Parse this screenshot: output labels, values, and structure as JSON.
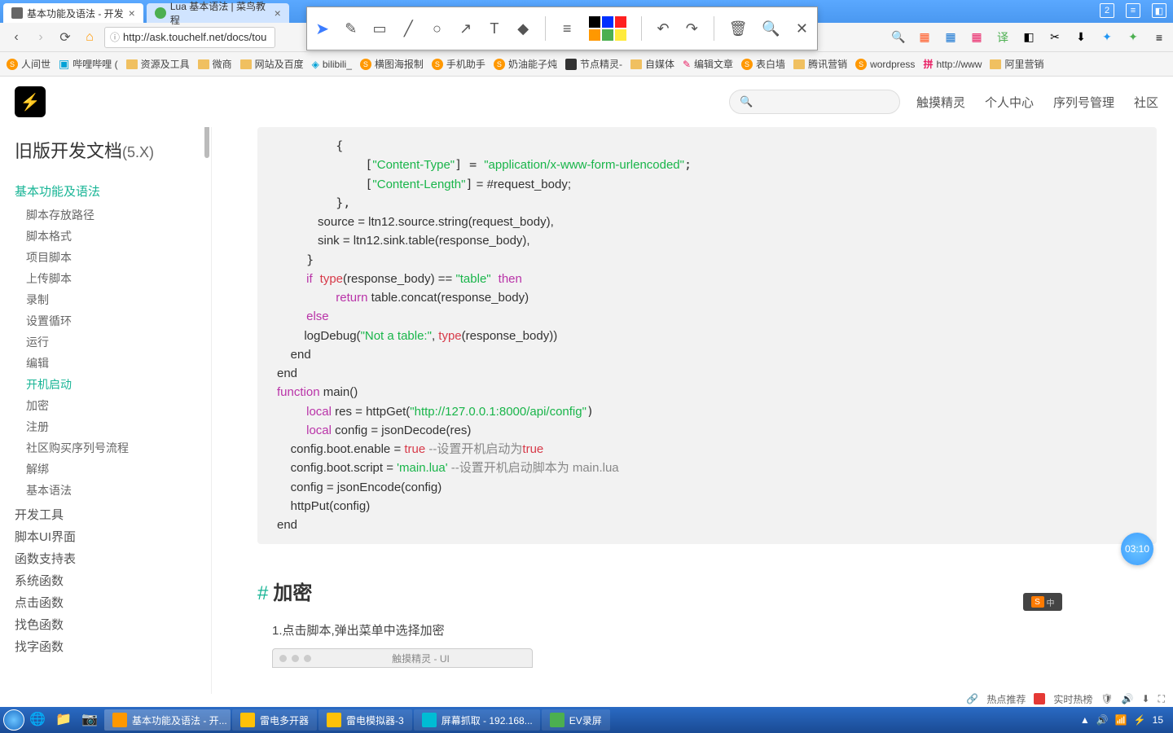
{
  "browser": {
    "tabs": [
      {
        "title": "基本功能及语法 - 开发",
        "active": true
      },
      {
        "title": "Lua 基本语法 | 菜鸟教程",
        "active": false
      }
    ],
    "tab_count_badge": "2",
    "url": "http://ask.touchelf.net/docs/tou"
  },
  "bookmarks": [
    {
      "label": "人间世",
      "kind": "s"
    },
    {
      "label": "哔哩哔哩 (",
      "kind": "bili"
    },
    {
      "label": "资源及工具",
      "kind": "folder"
    },
    {
      "label": "微商",
      "kind": "folder"
    },
    {
      "label": "网站及百度",
      "kind": "folder"
    },
    {
      "label": "bilibili_",
      "kind": "bili"
    },
    {
      "label": "横图海报制",
      "kind": "s"
    },
    {
      "label": "手机助手",
      "kind": "s"
    },
    {
      "label": "奶油能子炖",
      "kind": "s"
    },
    {
      "label": "节点精灵-",
      "kind": "node"
    },
    {
      "label": "自媒体",
      "kind": "folder"
    },
    {
      "label": "编辑文章",
      "kind": "edit"
    },
    {
      "label": "表白墙",
      "kind": "s"
    },
    {
      "label": "腾讯营销",
      "kind": "folder"
    },
    {
      "label": "wordpress",
      "kind": "s"
    },
    {
      "label": "http://www",
      "kind": "hk"
    },
    {
      "label": "阿里营销",
      "kind": "folder"
    }
  ],
  "site": {
    "search_placeholder": "",
    "nav": [
      "触摸精灵",
      "个人中心",
      "序列号管理",
      "社区"
    ]
  },
  "sidebar": {
    "title": "旧版开发文档",
    "version": "(5.X)",
    "category": "基本功能及语法",
    "items": [
      "脚本存放路径",
      "脚本格式",
      "项目脚本",
      "上传脚本",
      "录制",
      "设置循环",
      "运行",
      "编辑",
      "开机启动",
      "加密",
      "注册",
      "社区购买序列号流程",
      "解绑",
      "基本语法"
    ],
    "active_item": "开机启动",
    "other_cats": [
      "开发工具",
      "脚本UI界面",
      "函数支持表",
      "系统函数",
      "点击函数",
      "找色函数",
      "找字函数"
    ]
  },
  "code": {
    "ct_key": "\"Content-Type\"",
    "ct_val": "\"application/x-www-form-urlencoded\"",
    "cl_key": "\"Content-Length\"",
    "cl_tail": " = #request_body;",
    "src": "            source = ltn12.source.string(request_body),",
    "sink": "            sink = ltn12.sink.table(response_body),",
    "if_kw": "if",
    "type1": "type",
    "if_mid": "(response_body) == ",
    "table_str": "\"table\"",
    "then_kw": "then",
    "return_kw": "return",
    "return_tail": " table.concat(response_body)",
    "else_kw": "else",
    "log_head": "        logDebug(",
    "log_str": "\"Not a table:\"",
    "log_mid": ", ",
    "log_tail": "(response_body))",
    "end1": "    end",
    "end2": "end",
    "func_kw": "function",
    "func_tail": " main()",
    "local_kw": "local",
    "res_line": " res = httpGet(",
    "url_str": "\"http://127.0.0.1:8000/api/config\"",
    "cfg_line": " config = jsonDecode(res)",
    "enable_head": "    config.boot.enable = ",
    "true_kw": "true",
    "enable_com": " --设置开机启动为",
    "true_kw2": "true",
    "script_head": "    config.boot.script = ",
    "mainlua": "'main.lua'",
    "script_com": " --设置开机启动脚本为 main.lua",
    "encode": "    config = jsonEncode(config)",
    "put": "    httpPut(config)",
    "end3": "end"
  },
  "section": {
    "hash": "#",
    "title": "加密",
    "step1": "1.点击脚本,弹出菜单中选择加密",
    "mini_title": "触摸精灵 - UI"
  },
  "timer": "03:10",
  "hotbar": {
    "a": "热点推荐",
    "b": "实时热榜"
  },
  "taskbar": {
    "items": [
      {
        "label": "基本功能及语法 - 开...",
        "active": true
      },
      {
        "label": "雷电多开器"
      },
      {
        "label": "雷电模拟器-3"
      },
      {
        "label": "屏幕抓取 - 192.168..."
      },
      {
        "label": "EV录屏"
      }
    ],
    "time": "15"
  }
}
